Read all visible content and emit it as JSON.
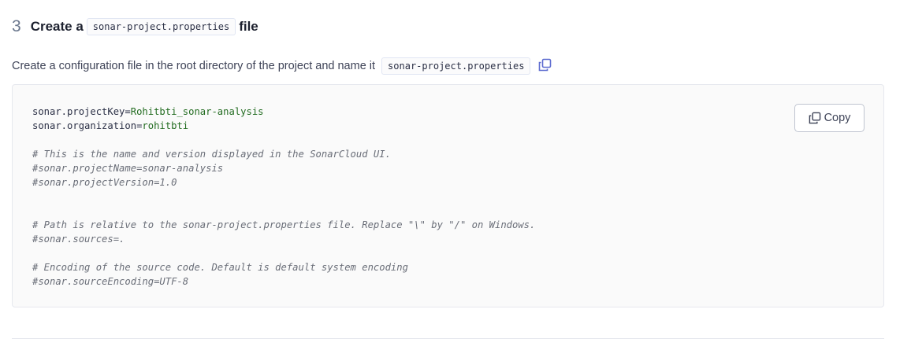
{
  "step": {
    "number": "3",
    "title_prefix": "Create a",
    "filename": "sonar-project.properties",
    "title_suffix": "file"
  },
  "description": {
    "text": "Create a configuration file in the root directory of the project and name it",
    "filename": "sonar-project.properties",
    "copy_icon": "copy-icon"
  },
  "code_block": {
    "copy_label": "Copy",
    "copy_icon": "copy-icon",
    "lines": [
      {
        "type": "prop",
        "key": "sonar.projectKey=",
        "value": "Rohitbti_sonar-analysis"
      },
      {
        "type": "prop",
        "key": "sonar.organization=",
        "value": "rohitbti"
      },
      {
        "type": "blank"
      },
      {
        "type": "comment",
        "text": "# This is the name and version displayed in the SonarCloud UI."
      },
      {
        "type": "comment",
        "text": "#sonar.projectName=sonar-analysis"
      },
      {
        "type": "comment",
        "text": "#sonar.projectVersion=1.0"
      },
      {
        "type": "blank"
      },
      {
        "type": "blank"
      },
      {
        "type": "comment",
        "text": "# Path is relative to the sonar-project.properties file. Replace \"\\\" by \"/\" on Windows."
      },
      {
        "type": "comment",
        "text": "#sonar.sources=."
      },
      {
        "type": "blank"
      },
      {
        "type": "comment",
        "text": "# Encoding of the source code. Default is default system encoding"
      },
      {
        "type": "comment",
        "text": "#sonar.sourceEncoding=UTF-8"
      }
    ]
  },
  "colors": {
    "value": "#236c21",
    "comment": "#6a6e78",
    "icon": "#5d6cd0"
  }
}
